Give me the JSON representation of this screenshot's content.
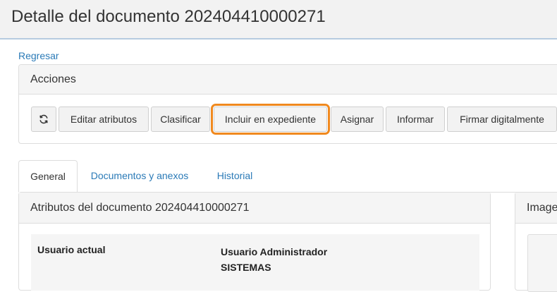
{
  "header": {
    "title": "Detalle del documento 202404410000271"
  },
  "back_link": "Regresar",
  "actions": {
    "title": "Acciones",
    "refresh_icon": "refresh-icon",
    "buttons": [
      "Editar atributos",
      "Clasificar",
      "Incluir en expediente",
      "Asignar",
      "Informar",
      "Firmar digitalmente"
    ],
    "highlighted": "Incluir en expediente",
    "highlight_color": "#f0891f"
  },
  "tabs": [
    {
      "label": "General",
      "active": true
    },
    {
      "label": "Documentos y anexos",
      "active": false
    },
    {
      "label": "Historial",
      "active": false
    }
  ],
  "attributes": {
    "title": "Atributos del documento 202404410000271",
    "rows": [
      {
        "label": "Usuario actual",
        "value_line1": "Usuario Administrador",
        "value_line2": "SISTEMAS"
      }
    ]
  },
  "image_panel": {
    "title": "Image"
  },
  "colors": {
    "link": "#2a7ab7",
    "header_bg": "#f2f2f2",
    "header_border": "#b6cbe0"
  }
}
